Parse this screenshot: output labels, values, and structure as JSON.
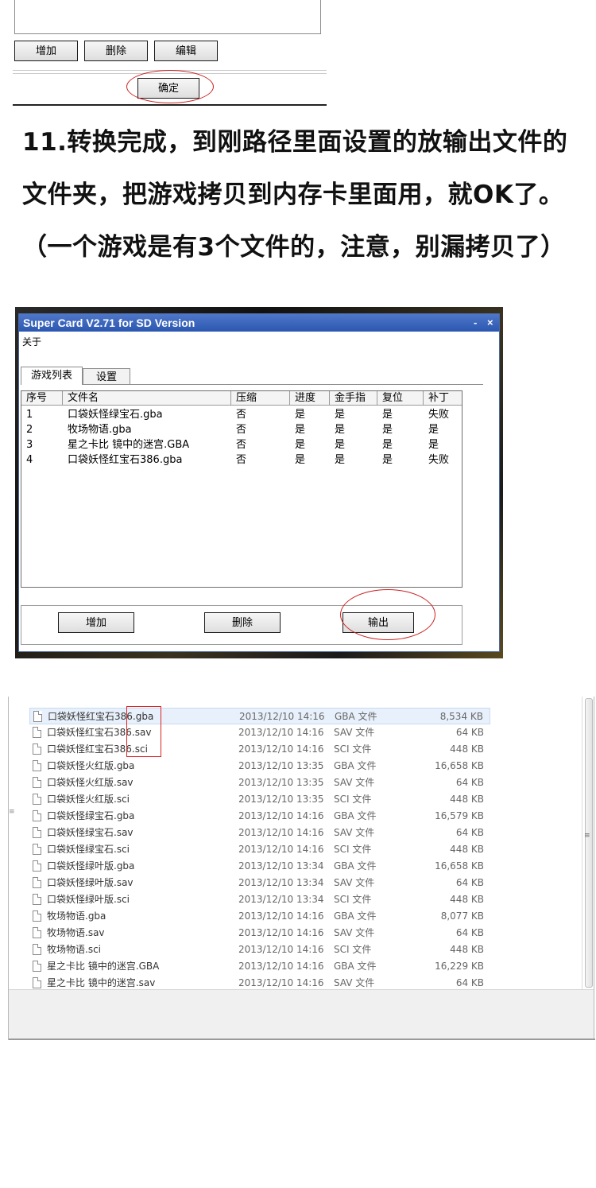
{
  "top_dialog": {
    "buttons": {
      "add": "增加",
      "delete": "删除",
      "edit": "编辑"
    },
    "ok": "确定"
  },
  "instruction": {
    "text": "11.转换完成，到刚路径里面设置的放输出文件的文件夹，把游戏拷贝到内存卡里面用，就OK了。（一个游戏是有3个文件的，注意，别漏拷贝了）"
  },
  "super_card": {
    "title": "Super Card V2.71 for SD Version",
    "controls": {
      "minimize": "-",
      "close": "×"
    },
    "menu": "关于",
    "tabs": [
      "游戏列表",
      "设置"
    ],
    "columns": [
      "序号",
      "文件名",
      "压缩",
      "进度",
      "金手指",
      "复位",
      "补丁"
    ],
    "rows": [
      [
        "1",
        "口袋妖怪绿宝石.gba",
        "否",
        "是",
        "是",
        "是",
        "失败"
      ],
      [
        "2",
        "牧场物语.gba",
        "否",
        "是",
        "是",
        "是",
        "是"
      ],
      [
        "3",
        "星之卡比 镜中的迷宫.GBA",
        "否",
        "是",
        "是",
        "是",
        "是"
      ],
      [
        "4",
        "口袋妖怪红宝石386.gba",
        "否",
        "是",
        "是",
        "是",
        "失败"
      ]
    ],
    "buttons": {
      "add": "增加",
      "delete": "删除",
      "output": "输出"
    }
  },
  "explorer": {
    "files": [
      {
        "name": "口袋妖怪红宝石386.gba",
        "date": "2013/12/10 14:16",
        "type": "GBA 文件",
        "size": "8,534 KB"
      },
      {
        "name": "口袋妖怪红宝石386.sav",
        "date": "2013/12/10 14:16",
        "type": "SAV 文件",
        "size": "64 KB"
      },
      {
        "name": "口袋妖怪红宝石386.sci",
        "date": "2013/12/10 14:16",
        "type": "SCI 文件",
        "size": "448 KB"
      },
      {
        "name": "口袋妖怪火红版.gba",
        "date": "2013/12/10 13:35",
        "type": "GBA 文件",
        "size": "16,658 KB"
      },
      {
        "name": "口袋妖怪火红版.sav",
        "date": "2013/12/10 13:35",
        "type": "SAV 文件",
        "size": "64 KB"
      },
      {
        "name": "口袋妖怪火红版.sci",
        "date": "2013/12/10 13:35",
        "type": "SCI 文件",
        "size": "448 KB"
      },
      {
        "name": "口袋妖怪绿宝石.gba",
        "date": "2013/12/10 14:16",
        "type": "GBA 文件",
        "size": "16,579 KB"
      },
      {
        "name": "口袋妖怪绿宝石.sav",
        "date": "2013/12/10 14:16",
        "type": "SAV 文件",
        "size": "64 KB"
      },
      {
        "name": "口袋妖怪绿宝石.sci",
        "date": "2013/12/10 14:16",
        "type": "SCI 文件",
        "size": "448 KB"
      },
      {
        "name": "口袋妖怪绿叶版.gba",
        "date": "2013/12/10 13:34",
        "type": "GBA 文件",
        "size": "16,658 KB"
      },
      {
        "name": "口袋妖怪绿叶版.sav",
        "date": "2013/12/10 13:34",
        "type": "SAV 文件",
        "size": "64 KB"
      },
      {
        "name": "口袋妖怪绿叶版.sci",
        "date": "2013/12/10 13:34",
        "type": "SCI 文件",
        "size": "448 KB"
      },
      {
        "name": "牧场物语.gba",
        "date": "2013/12/10 14:16",
        "type": "GBA 文件",
        "size": "8,077 KB"
      },
      {
        "name": "牧场物语.sav",
        "date": "2013/12/10 14:16",
        "type": "SAV 文件",
        "size": "64 KB"
      },
      {
        "name": "牧场物语.sci",
        "date": "2013/12/10 14:16",
        "type": "SCI 文件",
        "size": "448 KB"
      },
      {
        "name": "星之卡比 镜中的迷宫.GBA",
        "date": "2013/12/10 14:16",
        "type": "GBA 文件",
        "size": "16,229 KB"
      },
      {
        "name": "星之卡比 镜中的迷宫.sav",
        "date": "2013/12/10 14:16",
        "type": "SAV 文件",
        "size": "64 KB"
      }
    ],
    "icons": {
      "file": "file-icon"
    }
  },
  "colors": {
    "annotation_red": "#cc2222",
    "titlebar": "#2b57b0",
    "selection": "#e8f1fb"
  }
}
